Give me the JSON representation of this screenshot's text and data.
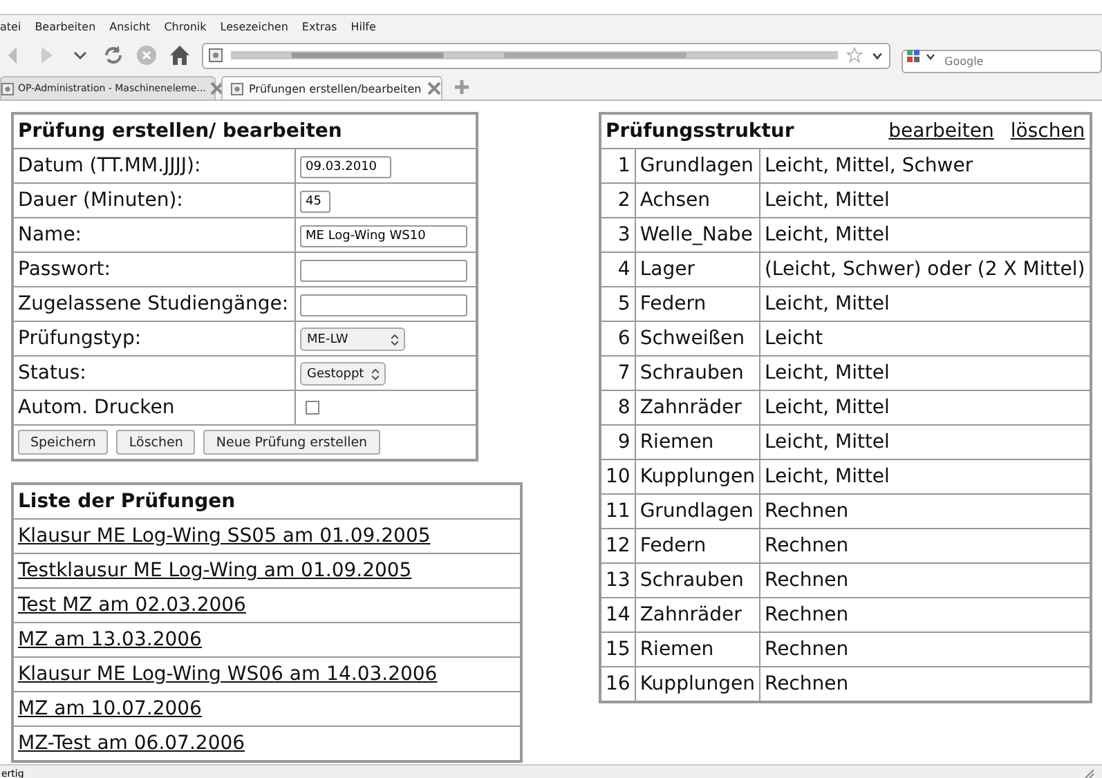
{
  "menu": [
    {
      "label": "atei"
    },
    {
      "label": "Bearbeiten"
    },
    {
      "label": "Ansicht"
    },
    {
      "label": "Chronik"
    },
    {
      "label": "Lesezeichen"
    },
    {
      "label": "Extras"
    },
    {
      "label": "Hilfe"
    }
  ],
  "search": {
    "placeholder": "Google"
  },
  "tabs": [
    {
      "title": "OP-Administration - Maschineneleme...",
      "selected": false
    },
    {
      "title": "Prüfungen erstellen/bearbeiten",
      "selected": true
    }
  ],
  "form": {
    "title": "Prüfung erstellen/ bearbeiten",
    "fields": [
      {
        "label": "Datum (TT.MM.JJJJ):",
        "kind": "date",
        "value": "09.03.2010"
      },
      {
        "label": "Dauer (Minuten):",
        "kind": "number",
        "value": "45"
      },
      {
        "label": "Name:",
        "kind": "text",
        "value": "ME Log-Wing WS10"
      },
      {
        "label": "Passwort:",
        "kind": "password"
      },
      {
        "label": "Zugelassene Studiengänge:",
        "kind": "text"
      },
      {
        "label": "Prüfungstyp:",
        "kind": "select",
        "value": "ME-LW"
      },
      {
        "label": "Status:",
        "kind": "select",
        "value": "Gestoppt"
      },
      {
        "label": "Autom. Drucken",
        "kind": "checkbox",
        "checked": false
      }
    ],
    "buttons": [
      "Speichern",
      "Löschen",
      "Neue Prüfung erstellen"
    ]
  },
  "exam_list": {
    "title": "Liste der Prüfungen",
    "items": [
      "Klausur ME Log-Wing SS05 am 01.09.2005",
      "Testklausur ME Log-Wing am 01.09.2005",
      "Test MZ am 02.03.2006",
      "MZ am 13.03.2006",
      "Klausur ME Log-Wing WS06 am 14.03.2006",
      "MZ am 10.07.2006",
      "MZ-Test am 06.07.2006"
    ]
  },
  "structure": {
    "title": "Prüfungsstruktur",
    "actions": [
      "bearbeiten",
      "löschen"
    ],
    "rows": [
      {
        "number": "1",
        "topic": "Grundlagen",
        "levels": "Leicht, Mittel, Schwer"
      },
      {
        "number": "2",
        "topic": "Achsen",
        "levels": "Leicht, Mittel"
      },
      {
        "number": "3",
        "topic": "Welle_Nabe",
        "levels": "Leicht, Mittel"
      },
      {
        "number": "4",
        "topic": "Lager",
        "levels": "(Leicht, Schwer) oder (2 X Mittel)"
      },
      {
        "number": "5",
        "topic": "Federn",
        "levels": "Leicht, Mittel"
      },
      {
        "number": "6",
        "topic": "Schweißen",
        "levels": "Leicht"
      },
      {
        "number": "7",
        "topic": "Schrauben",
        "levels": "Leicht, Mittel"
      },
      {
        "number": "8",
        "topic": "Zahnräder",
        "levels": "Leicht, Mittel"
      },
      {
        "number": "9",
        "topic": "Riemen",
        "levels": "Leicht, Mittel"
      },
      {
        "number": "10",
        "topic": "Kupplungen",
        "levels": "Leicht, Mittel"
      },
      {
        "number": "11",
        "topic": "Grundlagen",
        "levels": "Rechnen"
      },
      {
        "number": "12",
        "topic": "Federn",
        "levels": "Rechnen"
      },
      {
        "number": "13",
        "topic": "Schrauben",
        "levels": "Rechnen"
      },
      {
        "number": "14",
        "topic": "Zahnräder",
        "levels": "Rechnen"
      },
      {
        "number": "15",
        "topic": "Riemen",
        "levels": "Rechnen"
      },
      {
        "number": "16",
        "topic": "Kupplungen",
        "levels": "Rechnen"
      }
    ]
  },
  "status_bar": {
    "text": "ertig"
  }
}
